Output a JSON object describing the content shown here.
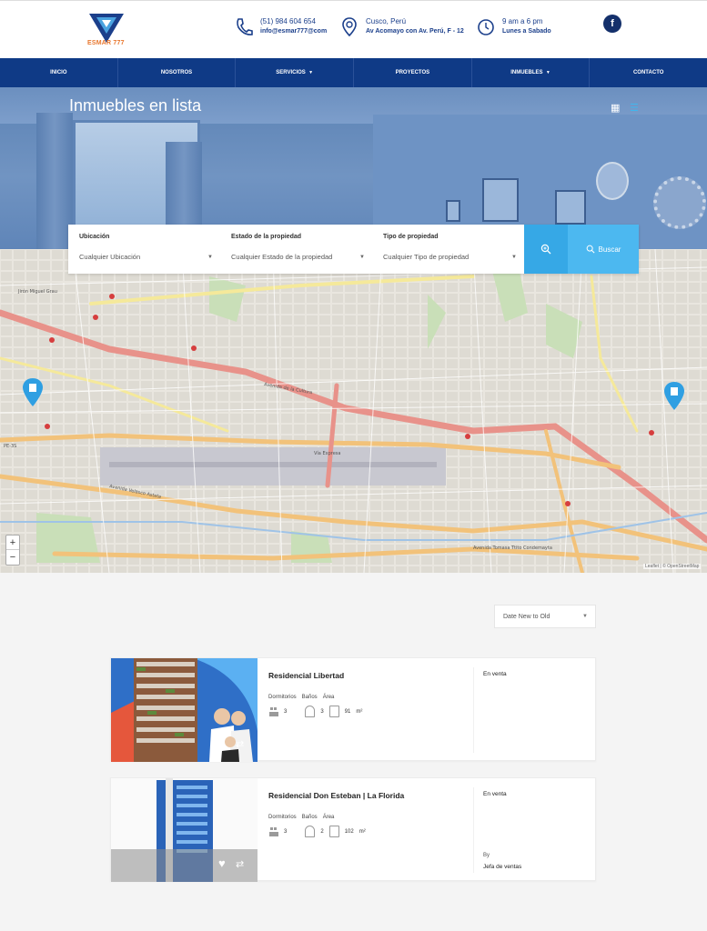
{
  "brand": {
    "name": "ESMAR 777"
  },
  "contact": {
    "phone": "(51) 984 604 654",
    "email": "info@esmar777@com",
    "city": "Cusco, Perú",
    "address": "Av Acomayo con Av. Perú, F - 12",
    "hours": "9 am a 6 pm",
    "days": "Lunes a Sabado"
  },
  "social": {
    "facebook_glyph": "f"
  },
  "nav": [
    {
      "label": "Inicio",
      "caret": ""
    },
    {
      "label": "Nosotros",
      "caret": ""
    },
    {
      "label": "Servicios",
      "caret": "▼"
    },
    {
      "label": "Proyectos",
      "caret": ""
    },
    {
      "label": "Inmuebles",
      "caret": "▼"
    },
    {
      "label": "Contacto",
      "caret": ""
    }
  ],
  "hero": {
    "title": "Inmuebles en lista"
  },
  "search": {
    "location_label": "Ubicación",
    "location_value": "Cualquier Ubicación",
    "status_label": "Estado de la propiedad",
    "status_value": "Cualquier Estado de la propiedad",
    "type_label": "Tipo de propiedad",
    "type_value": "Cualquier Tipo de propiedad",
    "button_label": "Buscar"
  },
  "map": {
    "zoom_in": "+",
    "zoom_out": "−",
    "attribution": "Leaflet | © OpenStreetMap",
    "streets": [
      "Avenida de la Cultura",
      "Vía Expresa",
      "Avenida Velasco Astete",
      "PE-3S",
      "Avenida Tomasa Ttito Condemayta",
      "Jirón Miguel Grau"
    ]
  },
  "sort": {
    "value": "Date New to Old"
  },
  "listings": [
    {
      "title": "Residencial Libertad",
      "labels": [
        "Dormitorios",
        "Baños",
        "Área"
      ],
      "bedrooms": "3",
      "bathrooms": "3",
      "area": "91",
      "area_unit": "m²",
      "status": "En venta",
      "by": "",
      "agent": ""
    },
    {
      "title": "Residencial Don Esteban | La Florida",
      "labels": [
        "Dormitorios",
        "Baños",
        "Área"
      ],
      "bedrooms": "3",
      "bathrooms": "2",
      "area": "102",
      "area_unit": "m²",
      "status": "En venta",
      "by": "By",
      "agent": "Jefa de ventas"
    }
  ],
  "colors": {
    "brand_blue": "#0f3a86",
    "accent": "#4cb8f0",
    "logo_orange": "#e8772e"
  }
}
